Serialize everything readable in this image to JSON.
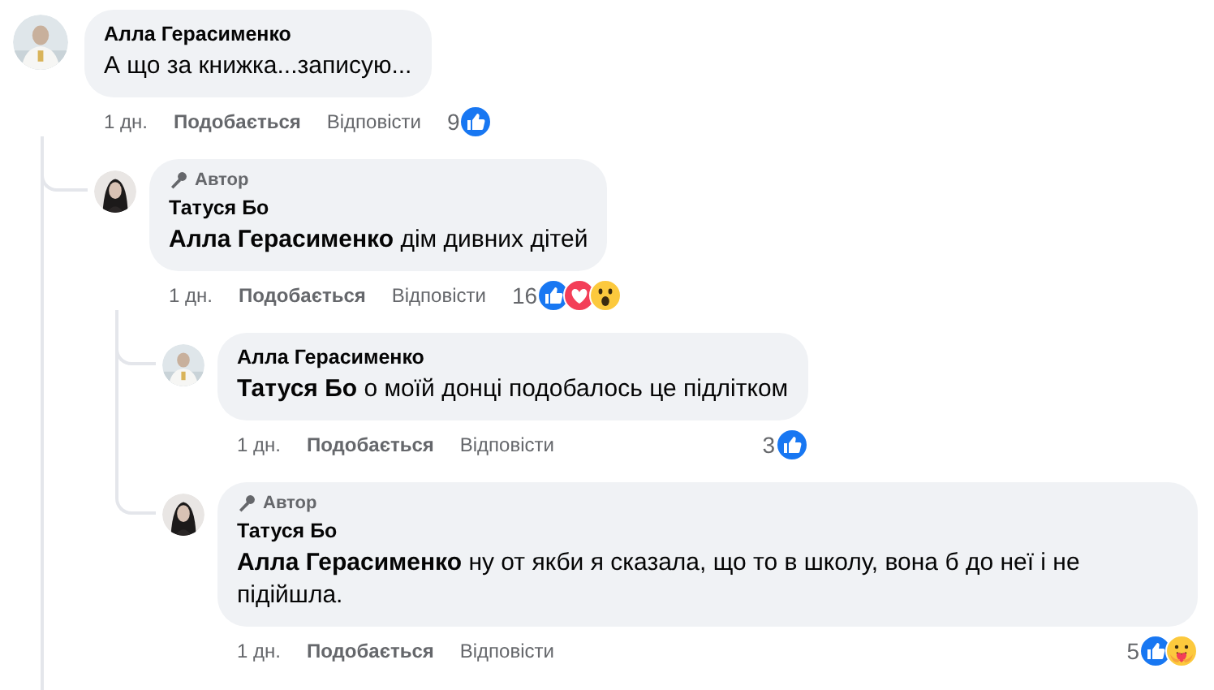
{
  "comments": [
    {
      "author": "Алла Герасименко",
      "text": "А що за книжка...записую...",
      "time": "1 дн.",
      "like_label": "Подобається",
      "reply_label": "Відповісти",
      "reaction_count": "9",
      "reactions": [
        {
          "kind": "like"
        }
      ],
      "children": [
        {
          "author": "Татуся Бо",
          "author_badge": "Автор",
          "text": "**Алла Герасименко** дім дивних дітей",
          "time": "1 дн.",
          "like_label": "Подобається",
          "reply_label": "Відповісти",
          "reaction_count": "16",
          "reactions": [
            {
              "kind": "like"
            },
            {
              "kind": "love"
            },
            {
              "kind": "wow"
            }
          ],
          "children": [
            {
              "author": "Алла Герасименко",
              "text": "**Татуся Бо** о моїй донці подобалось це підлітком",
              "time": "1 дн.",
              "like_label": "Подобається",
              "reply_label": "Відповісти",
              "reaction_count": "3",
              "reactions": [
                {
                  "kind": "like"
                }
              ]
            },
            {
              "author": "Татуся Бо",
              "author_badge": "Автор",
              "text": "**Алла Герасименко** ну от якби я сказала, що то в школу, вона б до неї і не підійшла.",
              "time": "1 дн.",
              "like_label": "Подобається",
              "reply_label": "Відповісти",
              "reaction_count": "5",
              "reactions": [
                {
                  "kind": "like"
                },
                {
                  "kind": "care"
                }
              ]
            }
          ]
        }
      ]
    }
  ]
}
